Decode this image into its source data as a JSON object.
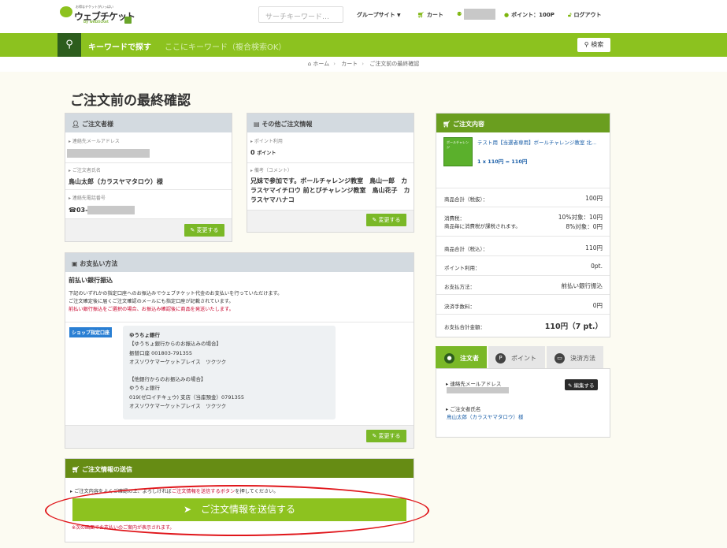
{
  "header": {
    "logo_tagline": "お得なチケットがいっぱい",
    "logo_name": "ウェブチケット",
    "logo_sub": "by webticket",
    "search_placeholder": "サーチキーワード…",
    "group_sites": "グループサイト",
    "cart": "カート",
    "points": "ポイント：100P",
    "logout": "ログアウト"
  },
  "searchbar": {
    "title": "キーワードで探す",
    "placeholder": "ここにキーワード（複合検索OK）",
    "button": "検索"
  },
  "breadcrumb": [
    "ホーム",
    "カート",
    "ご注文前の最終確認"
  ],
  "page_title": "ご注文前の最終確認",
  "orderer": {
    "header": "ご注文者様",
    "email_label": "連絡先メールアドレス",
    "name_label": "ご注文者氏名",
    "name_value": "鳥山太郎（カラスヤマタロウ）様",
    "phone_label": "連絡先電話番号",
    "phone_prefix": "03-",
    "change_button": "変更する"
  },
  "other_info": {
    "header": "その他ご注文情報",
    "points_label": "ポイント利用",
    "points_value": "0",
    "points_unit": "ポイント",
    "note_label": "備考（コメント）",
    "note_value": "兄妹で参加です。ボールチャレンジ教室　鳥山一郎　カラスヤマイチロウ 前とびチャレンジ教室　鳥山花子　カラスヤマハナコ",
    "change_button": "変更する"
  },
  "payment": {
    "header": "お支払い方法",
    "method": "前払い銀行振込",
    "desc1": "下記のいずれかの指定口座へのお振込みでウェブチケット代金のお支払いを行っていただけます。",
    "desc2": "ご注文確定後に届くご注文確認のメールにも指定口座が記載されています。",
    "desc_red": "前払い銀行振込をご選択の場合、お振込み確認後に商品を発送いたします。",
    "badge": "ショップ指定口座",
    "bank_lines": [
      "ゆうちょ銀行",
      "【ゆうちょ銀行からのお振込みの場合】",
      "振替口座 001803-791355",
      "オスソワケマーケットプレイス　ツクツク",
      "",
      "【他銀行からのお振込みの場合】",
      "ゆうちょ銀行",
      "019(ゼロイチキュウ) 支店（当座預金）0791355",
      "オスソワケマーケットプレイス　ツクツク"
    ],
    "change_button": "変更する"
  },
  "send": {
    "header": "ご注文情報の送信",
    "note_a": "ご注文内容をよくご確認の上、よろしければ",
    "note_b": "ご注文情報を送信するボタン",
    "note_c": "を押してください。",
    "button": "ご注文情報を送信する",
    "note_bottom": "※次の画面でお支払いのご案内が表示されます。"
  },
  "order": {
    "header": "ご注文内容",
    "thumb_text": "ボールチャレンジ",
    "item_title": "テスト用【当選者専用】ボールチャレンジ教室 北...",
    "item_qty": "1 x 110円 = 110円",
    "rows": [
      {
        "k": "商品合計（税抜）：",
        "v": "100円"
      },
      {
        "k": "消費税：",
        "v": "10%対象：10円"
      },
      {
        "k": "商品合計（税込）：",
        "v": "110円"
      },
      {
        "k": "ポイント利用：",
        "v": "0pt."
      },
      {
        "k": "お支払方法：",
        "v": "前払い銀行振込"
      },
      {
        "k": "決済手数料：",
        "v": "0円"
      },
      {
        "k": "お支払合計金額：",
        "v": "110円（7 pt.）"
      }
    ],
    "tax_note": "商品毎に消費税が課税されます。",
    "tax_8": "8%対象：0円"
  },
  "tabs": {
    "items": [
      "注文者",
      "ポイント",
      "決済方法"
    ],
    "email_label": "連絡先メールアドレス",
    "edit_button": "編集する",
    "name_label": "ご注文者氏名",
    "name_value": "鳥山太郎（カラスヤマタロウ）様"
  },
  "colors": {
    "accent": "#8dc21f",
    "dark_green": "#2d5d1d",
    "red": "#c8002a"
  }
}
